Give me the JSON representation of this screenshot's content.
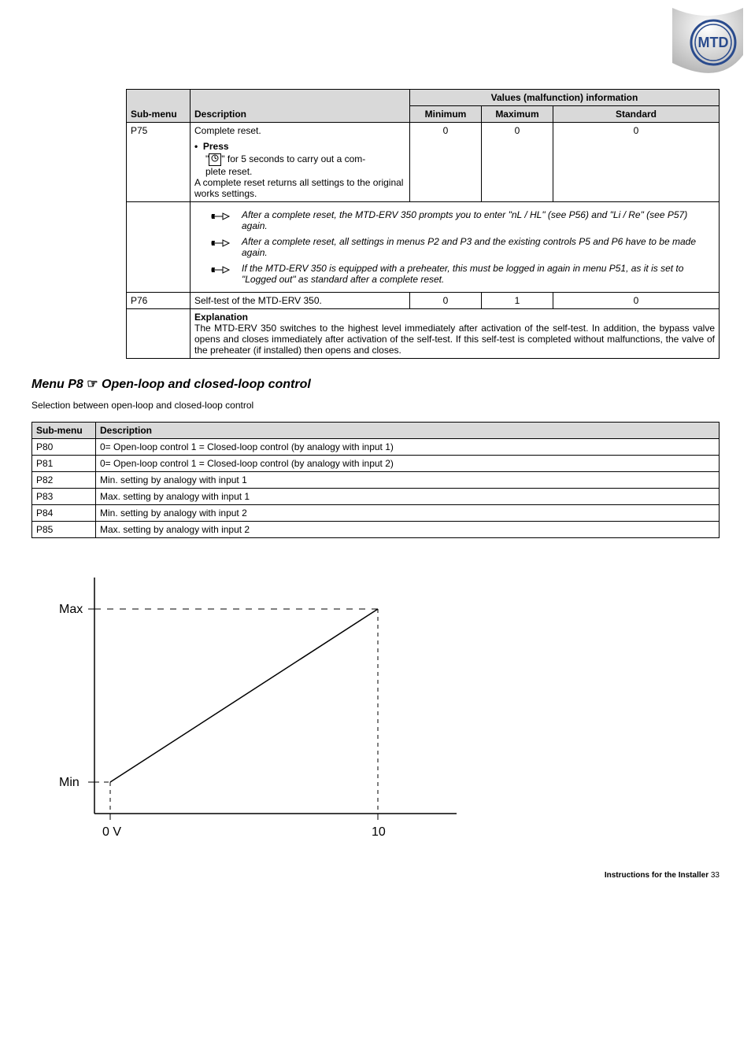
{
  "logo_text": "MTD",
  "table1": {
    "header_values": "Values (malfunction) information",
    "col_sub": "Sub-menu",
    "col_desc": "Description",
    "col_min": "Minimum",
    "col_max": "Maximum",
    "col_std": "Standard",
    "p75": {
      "id": "P75",
      "desc_line1": "Complete reset.",
      "bullet_press": "Press",
      "press_text_before": "\"",
      "press_text_after": "\" for 5 seconds to carry out a com-",
      "plete_reset": "plete reset.",
      "returns": "A complete reset returns all settings to the original works settings.",
      "min": "0",
      "max": "0",
      "std": "0",
      "note1": "After a complete reset, the  MTD-ERV 350 prompts you to enter \"nL / HL\" (see P56) and \"Li / Re\" (see P57) again.",
      "note2": "After a complete reset, all settings in menus P2 and P3 and the existing controls P5 and P6 have to be made again.",
      "note3": "If the  MTD-ERV 350 is equipped with a preheater, this must be logged in again in menu P51, as it is set to \"Logged out\" as standard after a complete reset."
    },
    "p76": {
      "id": "P76",
      "desc": "Self-test of the MTD-ERV 350.",
      "min": "0",
      "max": "1",
      "std": "0",
      "exp_label": "Explanation",
      "exp_text": "The MTD-ERV  350 switches to the highest level immediately after activation of the self-test. In addition, the bypass valve opens and closes immediately after activation of the self-test. If this self-test is completed without malfunctions, the valve of the preheater (if installed) then opens and closes."
    }
  },
  "menu_p8_title_prefix": "Menu P8 ",
  "menu_p8_title_suffix": " Open-loop and closed-loop control",
  "selection_text": "Selection between open-loop and closed-loop control",
  "table2": {
    "col_sub": "Sub-menu",
    "col_desc": "Description",
    "rows": [
      {
        "id": "P80",
        "desc": "0= Open-loop control 1 = Closed-loop control (by analogy with input 1)"
      },
      {
        "id": "P81",
        "desc": "0= Open-loop control 1 = Closed-loop control (by analogy with input 2)"
      },
      {
        "id": "P82",
        "desc": "Min. setting by analogy with input 1"
      },
      {
        "id": "P83",
        "desc": "Max. setting by analogy with input 1"
      },
      {
        "id": "P84",
        "desc": "Min. setting by analogy with input 2"
      },
      {
        "id": "P85",
        "desc": "Max. setting by analogy with input 2"
      }
    ]
  },
  "chart_data": {
    "type": "line",
    "y_max_label": "Max",
    "y_min_label": "Min",
    "x_min_label": "0 V",
    "x_max_label": "10",
    "x": [
      0,
      10
    ],
    "y": [
      "Min",
      "Max"
    ],
    "xlabel": "",
    "ylabel": "",
    "title": "",
    "dashed_guides": true
  },
  "footer_bold": "Instructions for the Installer",
  "footer_page": "  33"
}
